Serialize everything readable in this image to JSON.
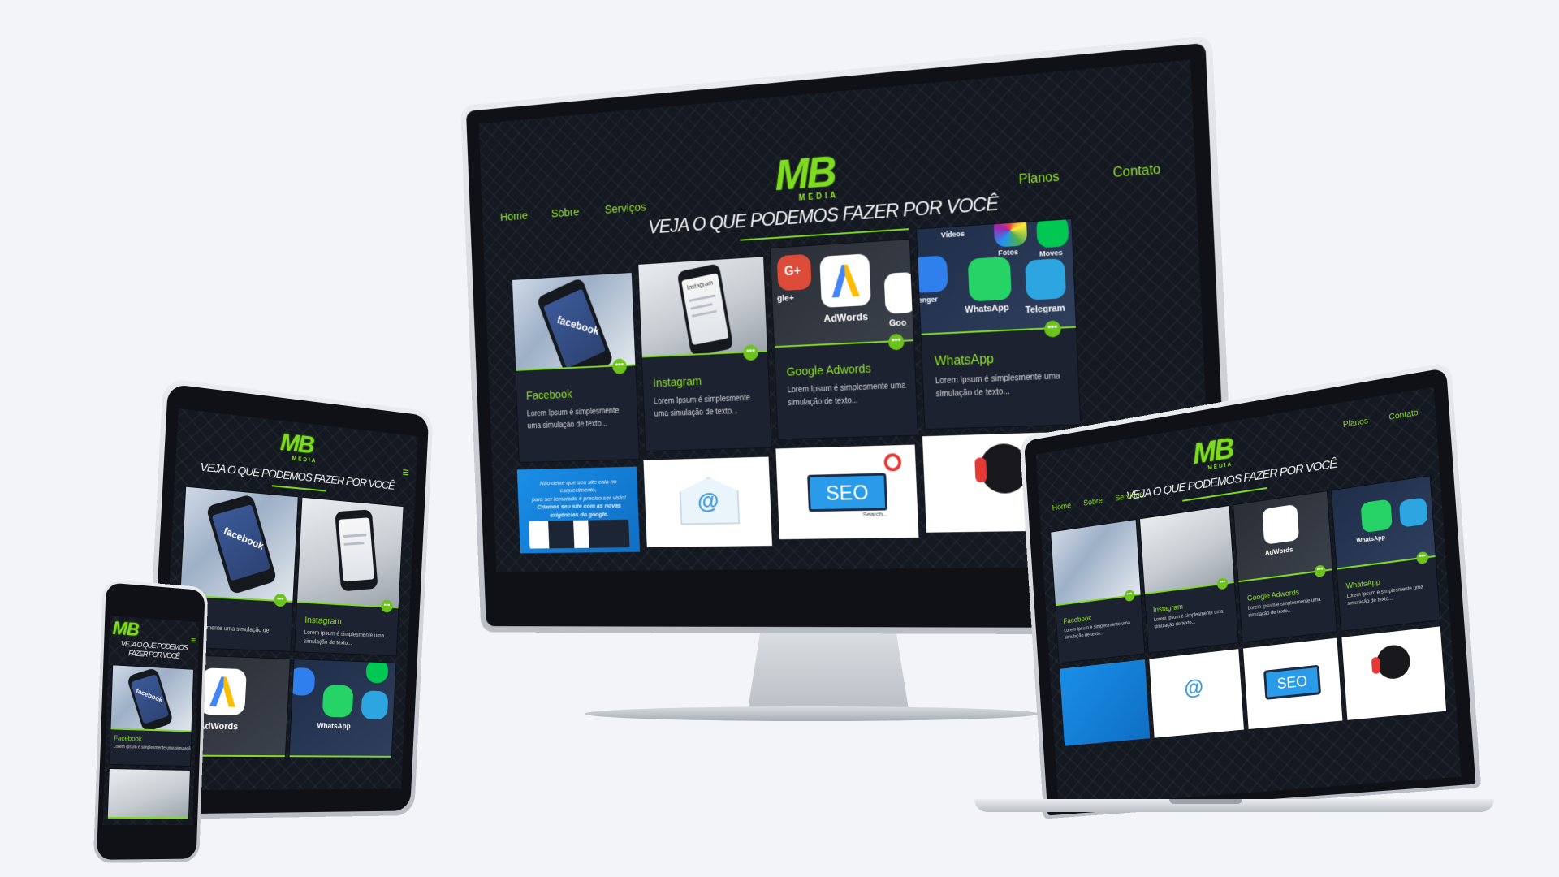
{
  "colors": {
    "accent": "#7ddc1f",
    "background": "#f3f4f7",
    "site_bg": "#141821",
    "card_bg": "#1c2230",
    "bezel": "#0f1116"
  },
  "site": {
    "logo": "MB",
    "logo_sub": "MEDIA",
    "headline": "VEJA O QUE PODEMOS FAZER POR VOCÊ",
    "headline_mobile_line1": "VEJA O QUE PODEMOS",
    "headline_mobile_line2": "FAZER POR VOCÊ",
    "nav": {
      "home": "Home",
      "sobre": "Sobre",
      "servicos": "Serviços",
      "planos": "Planos",
      "contato": "Contato"
    },
    "more_icon": "•••",
    "menu_icon": "≡",
    "cards": [
      {
        "title": "Facebook",
        "text": "Lorem Ipsum é simplesmente uma simulação de texto..."
      },
      {
        "title": "Instagram",
        "text": "Lorem Ipsum é simplesmente uma simulação de texto..."
      },
      {
        "title": "Google Adwords",
        "text": "Lorem Ipsum é simplesmente uma simulação de texto..."
      },
      {
        "title": "WhatsApp",
        "text": "Lorem Ipsum é simplesmente uma simulação de texto..."
      }
    ],
    "card_fragments": {
      "tablet_facebook": "ook",
      "tablet_text": "é simplesmente uma simulação de texto...",
      "tablet_instagram_text": "Lorem Ipsum é simplesmente uma simulação de texto..."
    },
    "image_labels": {
      "facebook": "facebook",
      "instagram": "Instagram",
      "adwords": "AdWords",
      "google": "Goo",
      "whatsapp": "WhatsApp",
      "telegram": "Telegram",
      "videos": "Vídeos",
      "fotos": "Fotos",
      "moves": "Moves",
      "messenger": "enger",
      "google_plus": "G+",
      "google_plus_label": "gle+"
    },
    "promo": {
      "line1": "Não deixe que seu site caia no esquecimento,",
      "line2": "para ser lembrado é preciso ser visto!",
      "line3": "Criamos seu site com as novas exigências do google."
    },
    "seo": {
      "board": "SEO",
      "search": "Search..."
    },
    "email_icon": "@"
  }
}
